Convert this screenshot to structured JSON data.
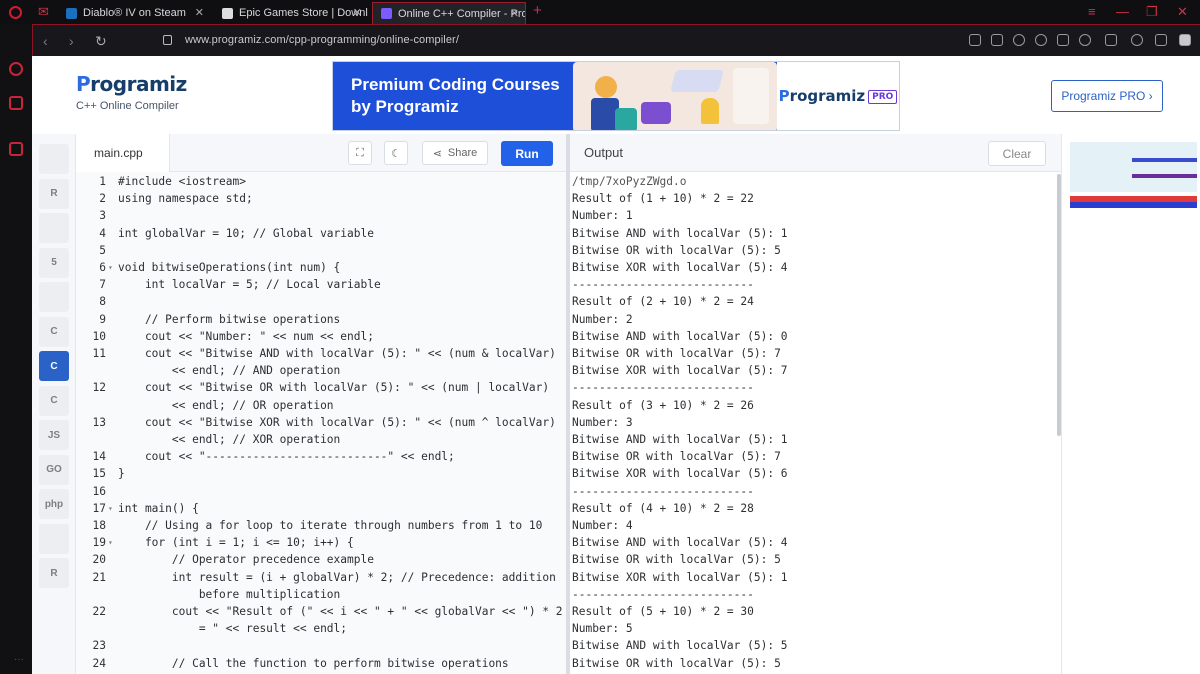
{
  "browser": {
    "tabs": [
      {
        "title": "Diablo® IV on Steam",
        "favicon_color": "#1b6fbf"
      },
      {
        "title": "Epic Games Store | Downlo",
        "favicon_color": "#dddddd"
      },
      {
        "title": "Online C++ Compiler - Pro",
        "favicon_color": "#7a5cff"
      }
    ],
    "url": "www.programiz.com/cpp-programming/online-compiler/",
    "accent": "#c8243a"
  },
  "site": {
    "brand": "rogramiz",
    "brand_initial": "P",
    "subtitle": "C++ Online Compiler",
    "banner": {
      "title": "Premium Coding Courses by Programiz",
      "logo": "rogramiz",
      "logo_initial": "P",
      "badge": "PRO"
    },
    "pro_button": "Programiz PRO ›"
  },
  "languages": [
    {
      "icon": "python-icon",
      "label": ""
    },
    {
      "icon": "r-icon",
      "label": "R"
    },
    {
      "icon": "sql-icon",
      "label": ""
    },
    {
      "icon": "html-icon",
      "label": "5"
    },
    {
      "icon": "java-icon",
      "label": ""
    },
    {
      "icon": "c-icon",
      "label": "C"
    },
    {
      "icon": "cpp-icon",
      "label": "C"
    },
    {
      "icon": "csharp-icon",
      "label": "C"
    },
    {
      "icon": "js-icon",
      "label": "JS"
    },
    {
      "icon": "go-icon",
      "label": "GO"
    },
    {
      "icon": "php-icon",
      "label": "php"
    },
    {
      "icon": "swift-icon",
      "label": ""
    },
    {
      "icon": "rust-icon",
      "label": "R"
    }
  ],
  "editor": {
    "file_name": "main.cpp",
    "share_label": "Share",
    "run_label": "Run",
    "lines": [
      {
        "n": "1",
        "t": "#include <iostream>"
      },
      {
        "n": "2",
        "t": "using namespace std;"
      },
      {
        "n": "3",
        "t": ""
      },
      {
        "n": "4",
        "t": "int globalVar = 10; // Global variable"
      },
      {
        "n": "5",
        "t": ""
      },
      {
        "n": "6",
        "t": "void bitwiseOperations(int num) {",
        "fold": true
      },
      {
        "n": "7",
        "t": "    int localVar = 5; // Local variable"
      },
      {
        "n": "8",
        "t": ""
      },
      {
        "n": "9",
        "t": "    // Perform bitwise operations"
      },
      {
        "n": "10",
        "t": "    cout << \"Number: \" << num << endl;"
      },
      {
        "n": "11",
        "t": "    cout << \"Bitwise AND with localVar (5): \" << (num & localVar)"
      },
      {
        "n": "",
        "t": "        << endl; // AND operation"
      },
      {
        "n": "12",
        "t": "    cout << \"Bitwise OR with localVar (5): \" << (num | localVar)"
      },
      {
        "n": "",
        "t": "        << endl; // OR operation"
      },
      {
        "n": "13",
        "t": "    cout << \"Bitwise XOR with localVar (5): \" << (num ^ localVar)"
      },
      {
        "n": "",
        "t": "        << endl; // XOR operation"
      },
      {
        "n": "14",
        "t": "    cout << \"---------------------------\" << endl;"
      },
      {
        "n": "15",
        "t": "}"
      },
      {
        "n": "16",
        "t": ""
      },
      {
        "n": "17",
        "t": "int main() {",
        "fold": true
      },
      {
        "n": "18",
        "t": "    // Using a for loop to iterate through numbers from 1 to 10"
      },
      {
        "n": "19",
        "t": "    for (int i = 1; i <= 10; i++) {",
        "fold": true
      },
      {
        "n": "20",
        "t": "        // Operator precedence example"
      },
      {
        "n": "21",
        "t": "        int result = (i + globalVar) * 2; // Precedence: addition"
      },
      {
        "n": "",
        "t": "            before multiplication"
      },
      {
        "n": "22",
        "t": "        cout << \"Result of (\" << i << \" + \" << globalVar << \") * 2"
      },
      {
        "n": "",
        "t": "            = \" << result << endl;"
      },
      {
        "n": "23",
        "t": ""
      },
      {
        "n": "24",
        "t": "        // Call the function to perform bitwise operations"
      }
    ]
  },
  "output": {
    "title": "Output",
    "clear_label": "Clear",
    "lines": [
      "/tmp/7xoPyzZWgd.o",
      "Result of (1 + 10) * 2 = 22",
      "Number: 1",
      "Bitwise AND with localVar (5): 1",
      "Bitwise OR with localVar (5): 5",
      "Bitwise XOR with localVar (5): 4",
      "---------------------------",
      "Result of (2 + 10) * 2 = 24",
      "Number: 2",
      "Bitwise AND with localVar (5): 0",
      "Bitwise OR with localVar (5): 7",
      "Bitwise XOR with localVar (5): 7",
      "---------------------------",
      "Result of (3 + 10) * 2 = 26",
      "Number: 3",
      "Bitwise AND with localVar (5): 1",
      "Bitwise OR with localVar (5): 7",
      "Bitwise XOR with localVar (5): 6",
      "---------------------------",
      "Result of (4 + 10) * 2 = 28",
      "Number: 4",
      "Bitwise AND with localVar (5): 4",
      "Bitwise OR with localVar (5): 5",
      "Bitwise XOR with localVar (5): 1",
      "---------------------------",
      "Result of (5 + 10) * 2 = 30",
      "Number: 5",
      "Bitwise AND with localVar (5): 5",
      "Bitwise OR with localVar (5): 5"
    ]
  }
}
